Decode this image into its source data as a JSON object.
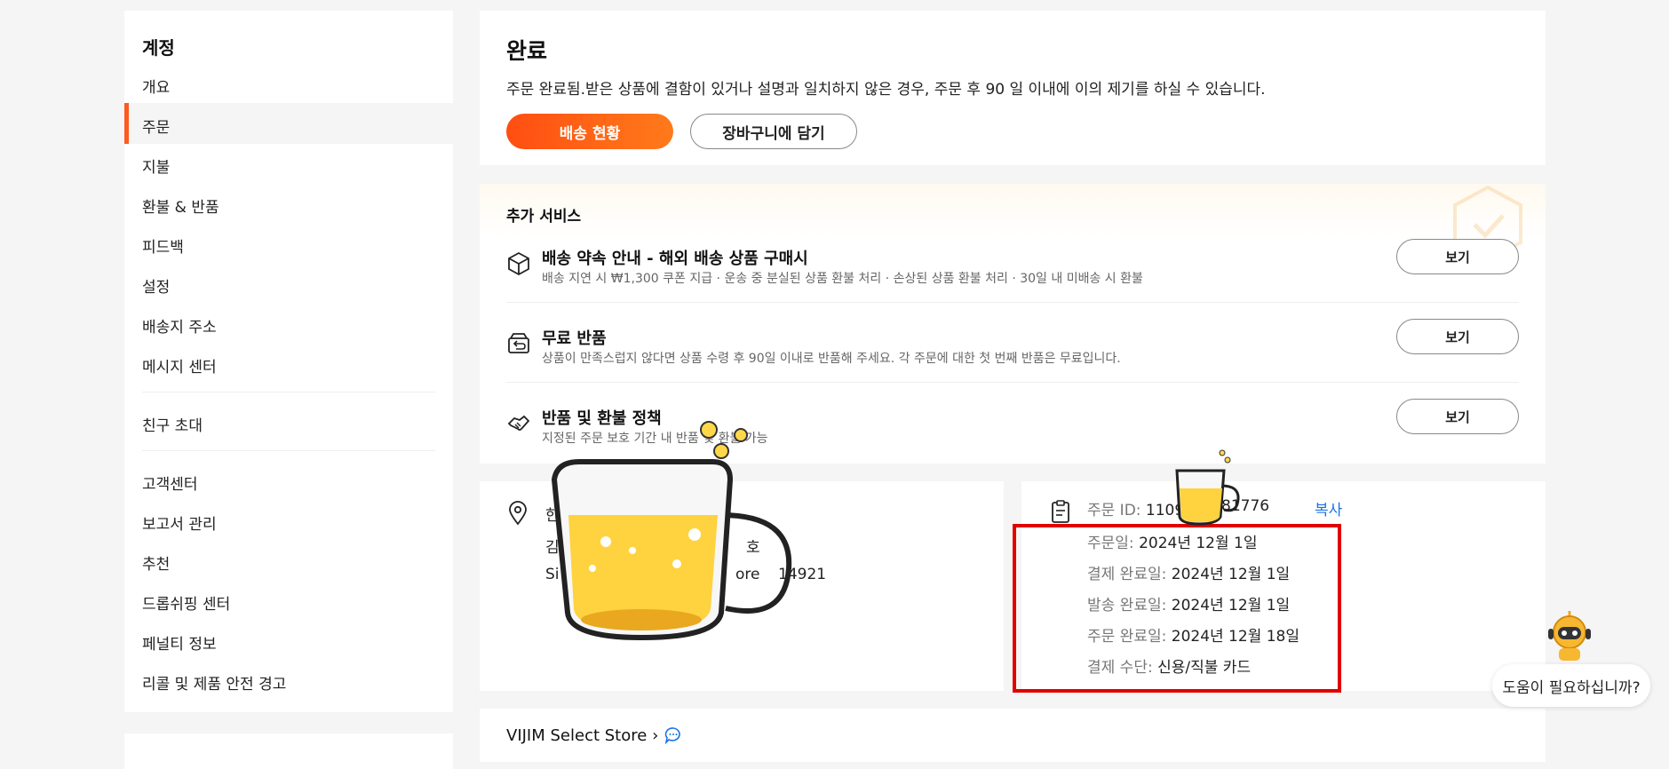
{
  "sidebar": {
    "title": "계정",
    "items": [
      {
        "label": "개요"
      },
      {
        "label": "주문"
      },
      {
        "label": "지불"
      },
      {
        "label": "환불 & 반품"
      },
      {
        "label": "피드백"
      },
      {
        "label": "설정"
      },
      {
        "label": "배송지 주소"
      },
      {
        "label": "메시지 센터"
      },
      {
        "label": "친구 초대"
      },
      {
        "label": "고객센터"
      },
      {
        "label": "보고서 관리"
      },
      {
        "label": "추천"
      },
      {
        "label": "드롭쉬핑 센터"
      },
      {
        "label": "페널티 정보"
      },
      {
        "label": "리콜 및 제품 안전 경고"
      }
    ]
  },
  "complete": {
    "title": "완료",
    "description": "주문 완료됨.받은 상품에 결함이 있거나 설명과 일치하지 않은 경우, 주문 후 90 일 이내에 이의 제기를 하실 수 있습니다.",
    "track_label": "배송 현황",
    "cart_label": "장바구니에 담기"
  },
  "services": {
    "heading": "추가 서비스",
    "items": [
      {
        "title": "배송 약속 안내 - 해외 배송 상품 구매시",
        "desc": "배송 지연 시 ₩1,300 쿠폰 지급 · 운송 중 분실된 상품 환불 처리 · 손상된 상품 환불 처리 · 30일 내 미배송 시 환불",
        "button": "보기"
      },
      {
        "title": "무료 반품",
        "desc": "상품이 만족스럽지 않다면 상품 수령 후 90일 이내로 반품해 주세요. 각 주문에 대한 첫 번째 반품은 무료입니다.",
        "button": "보기"
      },
      {
        "title": "반품 및 환불 정책",
        "desc": "지정된 주문 보호 기간 내 반품 및 환불 가능",
        "button": "보기"
      }
    ]
  },
  "address": {
    "line1": "한",
    "line2": "김",
    "line2b": "호",
    "line3a": "Si",
    "line3b": "ore",
    "line3c": "14921"
  },
  "order": {
    "id_label": "주문 ID:",
    "id_value_start": "1109",
    "id_value_end": "81776",
    "copy_label": "복사",
    "order_date_label": "주문일:",
    "order_date": "2024년 12월 1일",
    "paid_label": "결제 완료일:",
    "paid_date": "2024년 12월 1일",
    "shipped_label": "발송 완료일:",
    "shipped_date": "2024년 12월 1일",
    "completed_label": "주문 완료일:",
    "completed_date": "2024년 12월 18일",
    "payment_label": "결제 수단:",
    "payment_method": "신용/직불 카드"
  },
  "store": {
    "name": "VIJIM Select Store"
  },
  "help": {
    "label": "도움이 필요하십니까?"
  },
  "colors": {
    "accent": "#ff5a1f",
    "link": "#1a73e8",
    "highlight": "#e00000"
  }
}
